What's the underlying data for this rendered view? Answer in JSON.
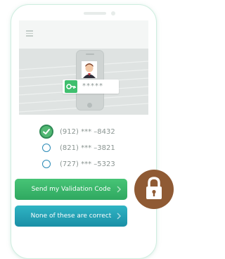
{
  "hero": {
    "password_mask": "*****"
  },
  "phone_options": [
    {
      "number": "(912) *** –8432",
      "selected": true
    },
    {
      "number": "(821) *** –3821",
      "selected": false
    },
    {
      "number": "(727) *** –5323",
      "selected": false
    }
  ],
  "buttons": {
    "send_label": "Send my Validation Code",
    "none_label": "None of these are correct"
  },
  "colors": {
    "send_button": "#3bb86b",
    "none_button": "#1fa1b5",
    "lock_badge": "#8f5a34",
    "radio_border": "#2a8ab6"
  },
  "icons": {
    "menu": "hamburger-icon",
    "key": "key-icon",
    "selected": "check-icon",
    "chevron": "chevron-right-icon",
    "lock": "padlock-icon"
  }
}
